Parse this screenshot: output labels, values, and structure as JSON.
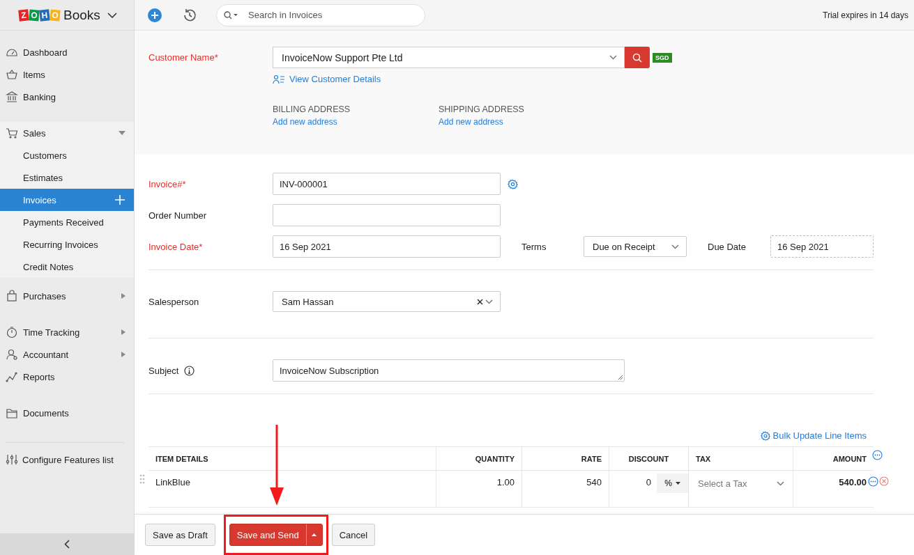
{
  "header": {
    "logo": {
      "letters": [
        {
          "char": "Z",
          "color": "#e42527"
        },
        {
          "char": "O",
          "color": "#089949"
        },
        {
          "char": "H",
          "color": "#226db4"
        },
        {
          "char": "O",
          "color": "#f9b21d"
        }
      ],
      "name": "Books"
    },
    "search": {
      "placeholder": "Search in Invoices"
    },
    "trial": "Trial expires in 14 days"
  },
  "sidebar": {
    "items": [
      {
        "label": "Dashboard"
      },
      {
        "label": "Items"
      },
      {
        "label": "Banking"
      },
      {
        "label": "Sales",
        "expanded": true,
        "children": [
          {
            "label": "Customers",
            "selected": false
          },
          {
            "label": "Estimates",
            "selected": false
          },
          {
            "label": "Invoices",
            "selected": true
          },
          {
            "label": "Payments Received",
            "selected": false
          },
          {
            "label": "Recurring Invoices",
            "selected": false
          },
          {
            "label": "Credit Notes",
            "selected": false
          }
        ]
      },
      {
        "label": "Purchases",
        "expanded": false
      },
      {
        "label": "Time Tracking",
        "expanded": false
      },
      {
        "label": "Accountant",
        "expanded": false
      },
      {
        "label": "Reports"
      },
      {
        "label": "Documents"
      }
    ],
    "footer": "Configure Features list"
  },
  "customer": {
    "label": "Customer Name*",
    "required": true,
    "value": "InvoiceNow Support Pte Ltd",
    "currency": "SGD",
    "details_link": "View Customer Details",
    "billing": {
      "title": "BILLING ADDRESS",
      "link": "Add new address"
    },
    "shipping": {
      "title": "SHIPPING ADDRESS",
      "link": "Add new address"
    }
  },
  "form": {
    "invoice_number": {
      "label": "Invoice#*",
      "required": true,
      "value": "INV-000001"
    },
    "order_number": {
      "label": "Order Number",
      "required": false
    },
    "invoice_date": {
      "label": "Invoice Date*",
      "required": true,
      "value": "16 Sep 2021"
    },
    "terms": {
      "label": "Terms",
      "value": "Due on Receipt"
    },
    "due_date": {
      "label": "Due Date",
      "value": "16 Sep 2021"
    },
    "salesperson": {
      "label": "Salesperson",
      "value": "Sam Hassan"
    },
    "subject": {
      "label": "Subject",
      "value": "InvoiceNow Subscription"
    }
  },
  "line_items": {
    "bulk_update": "Bulk Update Line Items",
    "columns": [
      "ITEM DETAILS",
      "QUANTITY",
      "RATE",
      "DISCOUNT",
      "TAX",
      "AMOUNT"
    ],
    "rows": [
      {
        "item": "LinkBlue",
        "quantity": "1.00",
        "rate": "540",
        "discount": "0",
        "discount_unit": "%",
        "tax_placeholder": "Select a Tax",
        "amount": "540.00"
      }
    ]
  },
  "footer": {
    "buttons": [
      {
        "label": "Save as Draft",
        "kind": "secondary",
        "highlighted": false
      },
      {
        "label": "Save and Send",
        "kind": "primary-split",
        "highlighted": true
      },
      {
        "label": "Cancel",
        "kind": "secondary",
        "highlighted": false
      }
    ]
  }
}
